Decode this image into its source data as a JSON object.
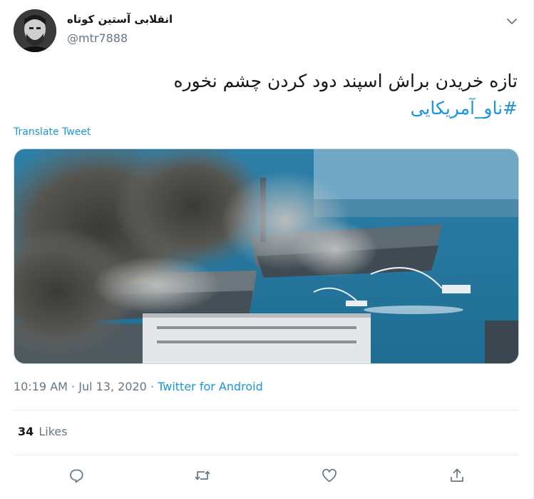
{
  "author": {
    "display_name": "انقلابی آستین کوتاه",
    "handle": "@mtr7888"
  },
  "tweet": {
    "text_line1": "تازه خریدن براش اسپند دود کردن چشم نخوره",
    "hashtag": "#ناو_آمریکایی",
    "translate_label": "Translate Tweet"
  },
  "meta": {
    "time": "10:19 AM",
    "separator": " · ",
    "date": "Jul 13, 2020",
    "source": "Twitter for Android"
  },
  "stats": {
    "likes_count": "34",
    "likes_label": "Likes"
  },
  "icons": {
    "more": "chevron-down-icon",
    "reply": "reply-icon",
    "retweet": "retweet-icon",
    "like": "heart-icon",
    "share": "share-icon"
  },
  "colors": {
    "accent": "#1b95e0",
    "secondary_text": "#657786",
    "divider": "#e6ecf0"
  }
}
